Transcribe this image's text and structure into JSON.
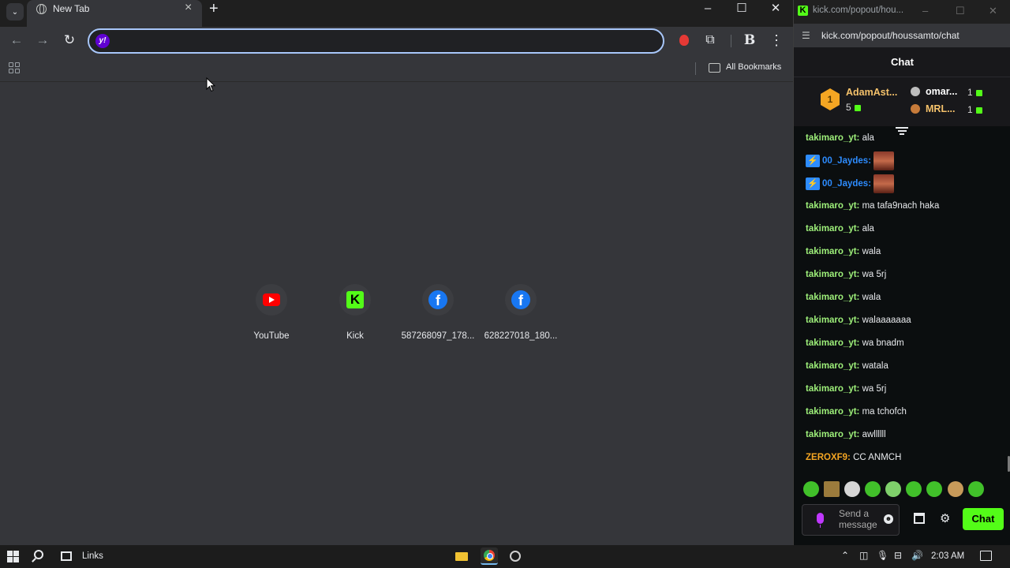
{
  "browser": {
    "tab_title": "New Tab",
    "omnibox_value": "",
    "bookmarks_label": "All Bookmarks",
    "shortcuts": [
      {
        "label": "YouTube",
        "icon": "youtube-icon"
      },
      {
        "label": "Kick",
        "icon": "kick-icon"
      },
      {
        "label": "587268097_178...",
        "icon": "facebook-icon"
      },
      {
        "label": "628227018_180...",
        "icon": "facebook-icon"
      }
    ]
  },
  "popout": {
    "window_title": "kick.com/popout/hou...",
    "url": "kick.com/popout/houssamto/chat",
    "header_title": "Chat",
    "top_gifter": {
      "rank": "1",
      "name": "AdamAst...",
      "count": "5"
    },
    "gifters": [
      {
        "name": "omar...",
        "count": "1",
        "color": "#ffffff"
      },
      {
        "name": "MRL...",
        "count": "1",
        "color": "#f5c26b"
      }
    ],
    "messages": [
      {
        "user": "takimaro_yt:",
        "text": "ala"
      },
      {
        "user": "00_Jaydes:",
        "text": ""
      },
      {
        "user": "00_Jaydes:",
        "text": ""
      },
      {
        "user": "takimaro_yt:",
        "text": "ma tafa9nach haka"
      },
      {
        "user": "takimaro_yt:",
        "text": "ala"
      },
      {
        "user": "takimaro_yt:",
        "text": "wala"
      },
      {
        "user": "takimaro_yt:",
        "text": "wa 5rj"
      },
      {
        "user": "takimaro_yt:",
        "text": "wala"
      },
      {
        "user": "takimaro_yt:",
        "text": "walaaaaaaa"
      },
      {
        "user": "takimaro_yt:",
        "text": "wa bnadm"
      },
      {
        "user": "takimaro_yt:",
        "text": "watala"
      },
      {
        "user": "takimaro_yt:",
        "text": "wa 5rj"
      },
      {
        "user": "takimaro_yt:",
        "text": "ma tchofch"
      },
      {
        "user": "takimaro_yt:",
        "text": "awllllll"
      },
      {
        "user": "ZEROXF9:",
        "text": "CC ANMCH"
      }
    ],
    "input_placeholder": "Send a message",
    "send_label": "Chat",
    "colors": {
      "kick_green": "#53fc18",
      "username_green": "#9ef07a",
      "username_blue": "#2d8cff",
      "username_orange": "#f5a623"
    }
  },
  "taskbar": {
    "links_label": "Links",
    "time": "2:03 AM"
  }
}
